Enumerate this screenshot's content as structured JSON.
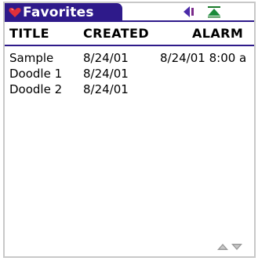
{
  "app": {
    "title": "Favorites",
    "accent_color": "#2e1a8a",
    "heart_color": "#e0303a",
    "toolbar_icons": [
      "back-arrow-icon",
      "scroll-to-top-icon"
    ]
  },
  "table": {
    "headers": {
      "title": "TITLE",
      "created": "CREATED",
      "alarm": "ALARM"
    },
    "rows": [
      {
        "title": "Sample",
        "created": "8/24/01",
        "alarm": "8/24/01 8:00 a"
      },
      {
        "title": "Doodle 1",
        "created": "8/24/01",
        "alarm": ""
      },
      {
        "title": "Doodle 2",
        "created": "8/24/01",
        "alarm": ""
      }
    ]
  },
  "scroll": {
    "icons": [
      "scroll-up-icon",
      "scroll-down-icon"
    ]
  }
}
